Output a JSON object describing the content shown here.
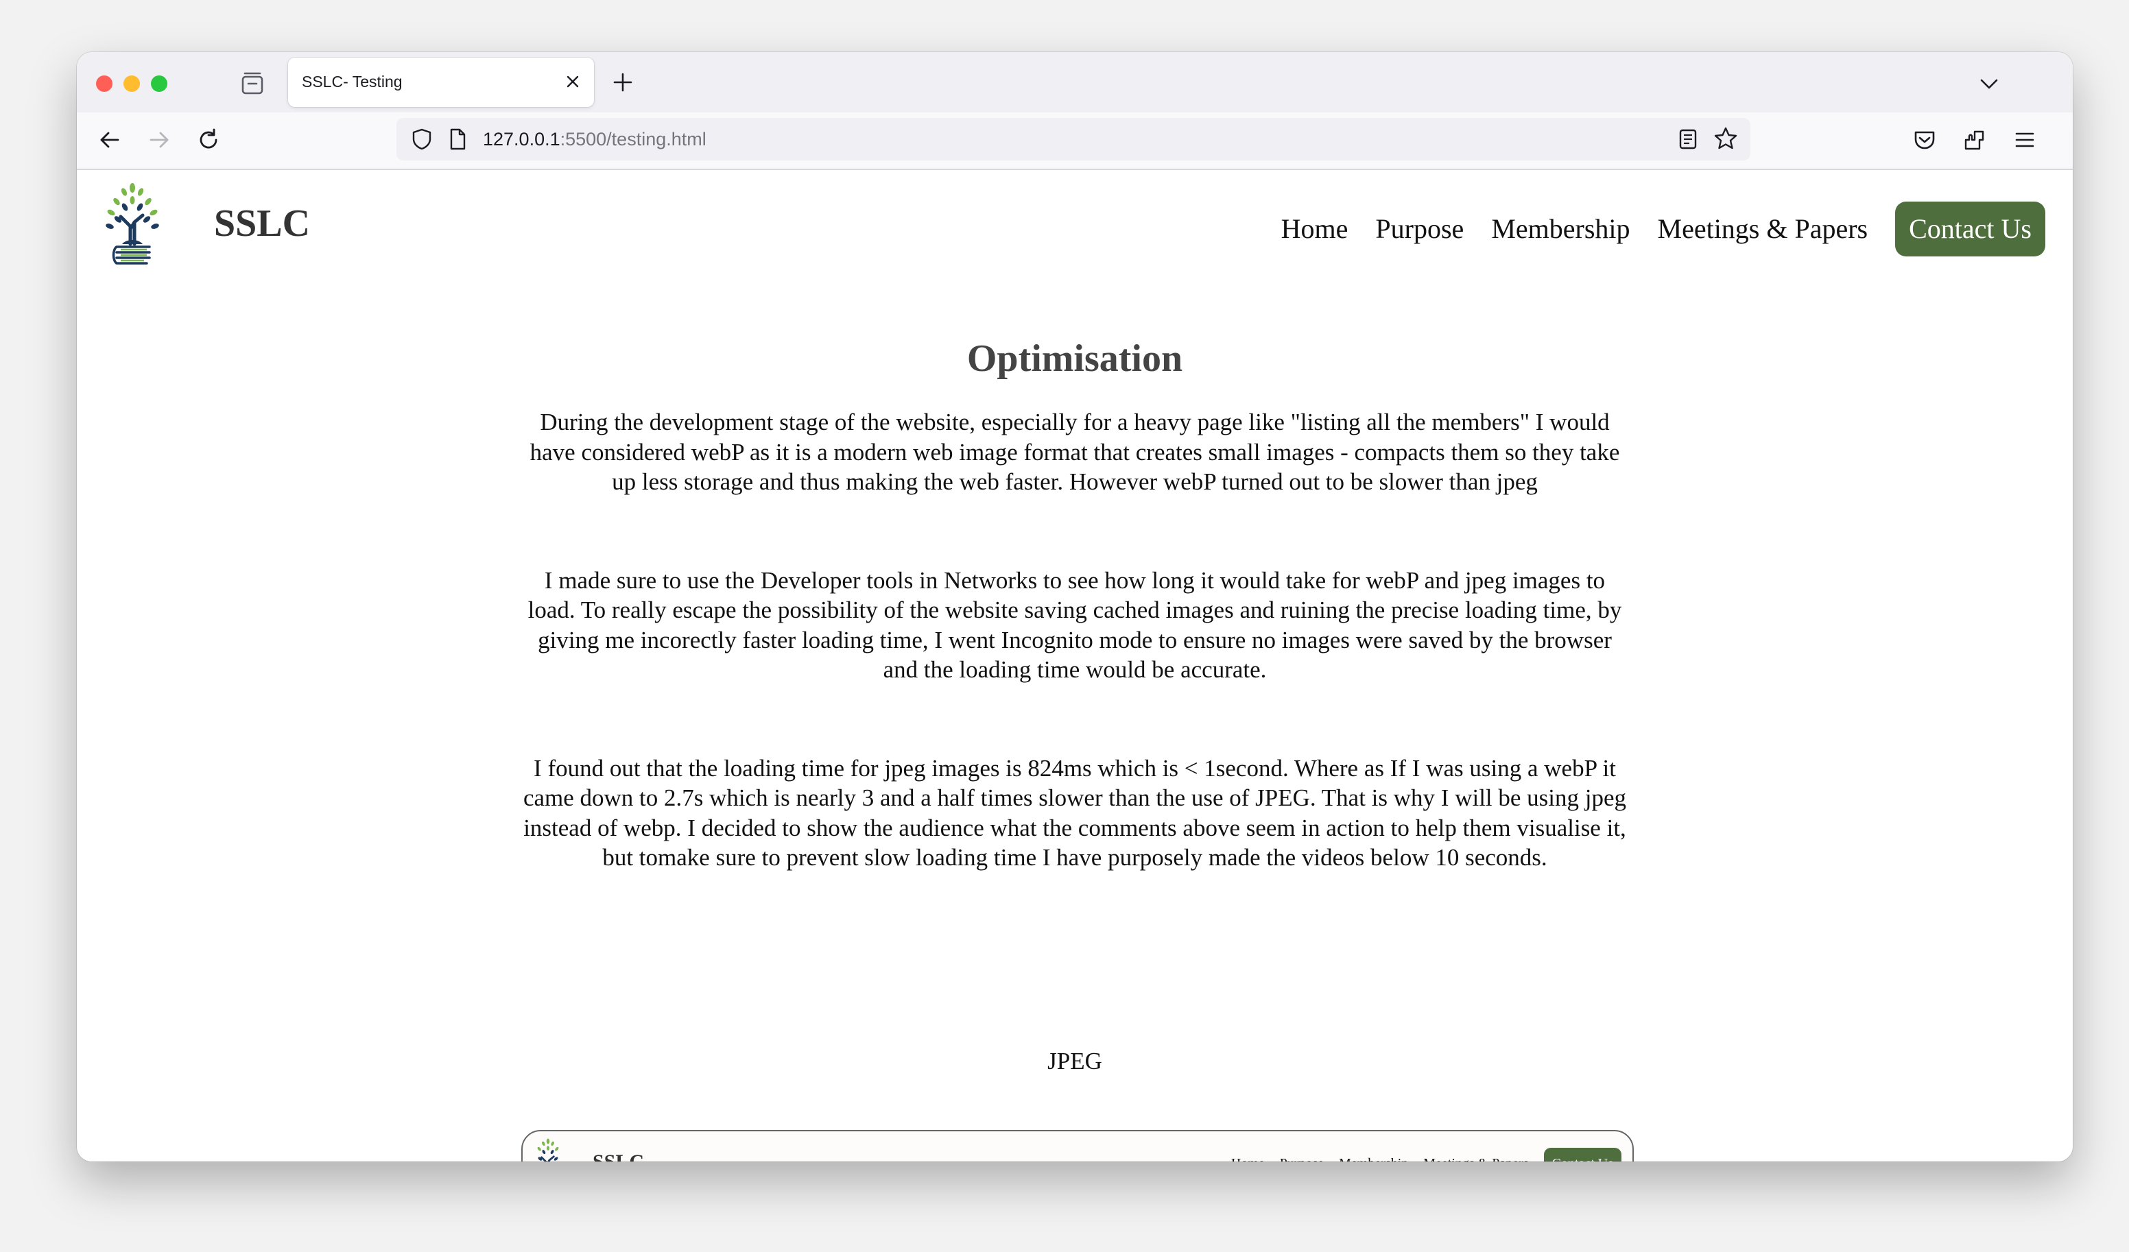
{
  "browser": {
    "tab_title": "SSLC- Testing",
    "url_host": "127.0.0.1",
    "url_rest": ":5500/testing.html"
  },
  "site": {
    "brand": "SSLC",
    "nav": {
      "home": "Home",
      "purpose": "Purpose",
      "membership": "Membership",
      "meetings": "Meetings & Papers",
      "contact": "Contact Us"
    },
    "accent_color": "#4f6e3e"
  },
  "content": {
    "title": "Optimisation",
    "paragraphs": [
      "During the development stage of the website, especially for a heavy page like \"listing all the members\" I would have considered webP as it is a modern web image format that creates small images - compacts them so they take up less storage and thus making the web faster. However webP turned out to be slower than jpeg",
      "I made sure to use the Developer tools in Networks to see how long it would take for webP and jpeg images to load. To really escape the possibility of the website saving cached images and ruining the precise loading time, by giving me incorectly faster loading time, I went Incognito mode to ensure no images were saved by the browser and the loading time would be accurate.",
      "I found out that the loading time for jpeg images is 824ms which is < 1second. Where as If I was using a webP it came down to 2.7s which is nearly 3 and a half times slower than the use of JPEG. That is why I will be using jpeg instead of webp. I decided to show the audience what the comments above seem in action to help them visualise it, but tomake sure to prevent slow loading time I have purposely made the videos below 10 seconds."
    ],
    "jpeg_label": "JPEG"
  },
  "preview": {
    "brand": "SSLC",
    "nav": {
      "home": "Home",
      "purpose": "Purpose",
      "membership": "Membership",
      "meetings": "Meetings & Papers",
      "contact": "Contact Us"
    }
  }
}
